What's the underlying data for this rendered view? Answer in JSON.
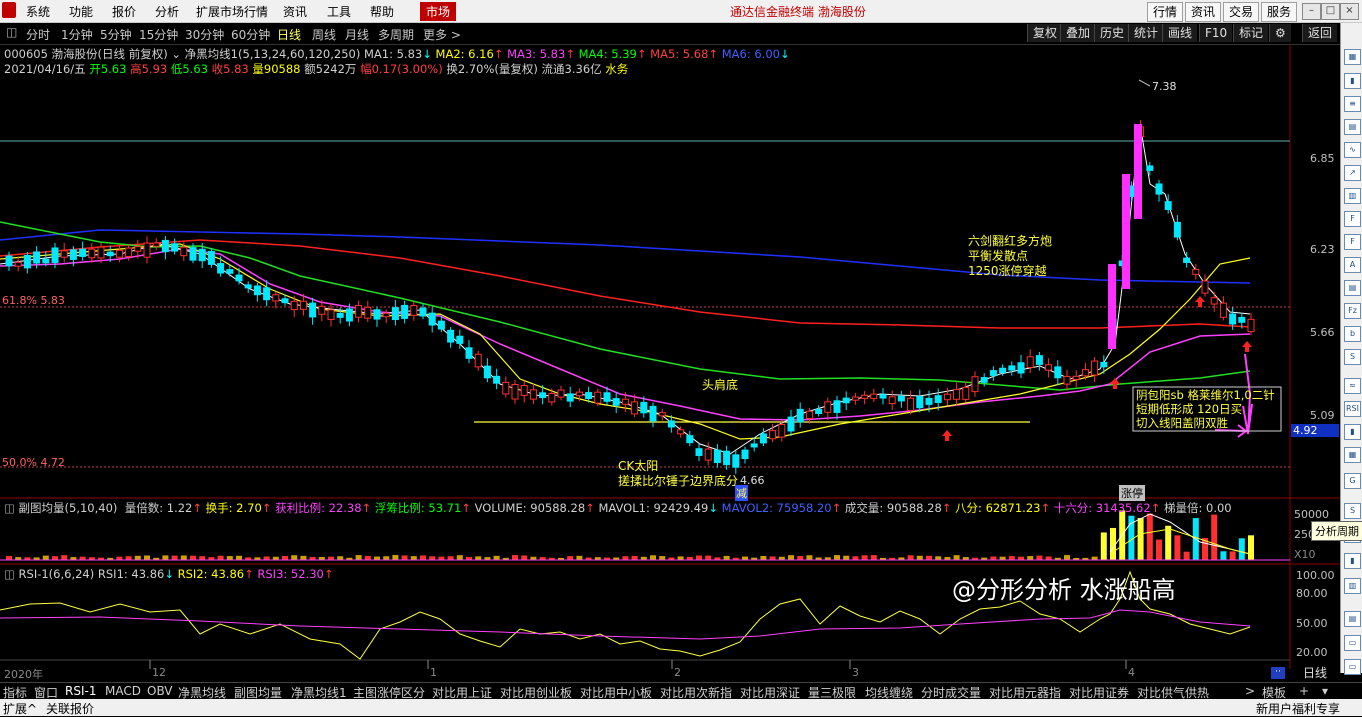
{
  "menu": {
    "items": [
      "系统",
      "功能",
      "报价",
      "分析",
      "扩展市场行情",
      "资讯",
      "工具",
      "帮助"
    ],
    "market": "市场",
    "brand": "通达信金融终端  渤海股份",
    "right_buttons": [
      "行情",
      "资讯",
      "交易",
      "服务"
    ]
  },
  "toolbar": {
    "periods": [
      "分时",
      "1分钟",
      "5分钟",
      "15分钟",
      "30分钟",
      "60分钟",
      "日线",
      "周线",
      "月线",
      "多周期",
      "更多 >"
    ],
    "active": "日线",
    "right": [
      "复权",
      "叠加",
      "历史",
      "统计",
      "画线",
      "F10",
      "标记",
      "⚙",
      "返回"
    ]
  },
  "header": {
    "line1": {
      "code": "000605 渤海股份(日线 前复权)",
      "indicator": "净黑均线1(5,13,24,60,120,250)",
      "ma1": "MA1: 5.83",
      "ma2": "MA2: 6.16",
      "ma3": "MA3: 5.83",
      "ma4": "MA4: 5.39",
      "ma5": "MA5: 5.68",
      "ma6": "MA6: 6.00"
    },
    "line2": {
      "date": "2021/04/16/五",
      "open": "开5.63",
      "high": "高5.93",
      "low": "低5.63",
      "close": "收5.83",
      "vol": "量90588",
      "amount": "额5242万",
      "change": "幅0.17(3.00%)",
      "turnover": "换2.70%(量复权)",
      "float": "流通3.36亿",
      "sector": "水务"
    }
  },
  "price_axis": [
    "6.85",
    "6.23",
    "5.66",
    "5.09"
  ],
  "price_current": "4.92",
  "fib": {
    "top": "61.8% 5.83",
    "bottom": "50.0% 4.72"
  },
  "annotations": {
    "peak": "7.38",
    "low": "4.66",
    "liujian": [
      "六剑翻红多方炮",
      "平衡发散点",
      "1250涨停穿越"
    ],
    "toujian": "头肩底",
    "ck": [
      "CK太阳",
      "搓揉比尔锤子边界底分"
    ],
    "jian": "减",
    "zhangting": "涨停",
    "box": [
      "阴包阳sb 格莱维尔1,0二针",
      "短期低形成 120日买",
      "切入线阳盖阴双胜"
    ],
    "watermark": "@分形分析 水涨船高"
  },
  "sub1": {
    "name": "副图均量(5,10,40)",
    "items": [
      {
        "t": "量倍数: 1.22",
        "c": "w"
      },
      {
        "t": "换手: 2.70",
        "c": "y"
      },
      {
        "t": "获利比例: 22.38",
        "c": "m"
      },
      {
        "t": "浮筹比例: 53.71",
        "c": "g"
      },
      {
        "t": "VOLUME: 90588.28",
        "c": "w"
      },
      {
        "t": "MAVOL1: 92429.49",
        "c": "w"
      },
      {
        "t": "MAVOL2: 75958.20",
        "c": "b"
      },
      {
        "t": "成交量: 90588.28",
        "c": "w"
      },
      {
        "t": "八分: 62871.23",
        "c": "y"
      },
      {
        "t": "十六分: 31435.62",
        "c": "m"
      },
      {
        "t": "梯量倍: 0.00",
        "c": "w"
      }
    ],
    "axis": [
      "50000",
      "25000"
    ],
    "unit": "X10",
    "tooltip": "分析周期"
  },
  "sub2": {
    "name": "RSI-1(6,6,24)",
    "rsi1": "RSI1: 43.86",
    "rsi2": "RSI2: 43.86",
    "rsi3": "RSI3: 52.30",
    "axis": [
      "100.00",
      "80.00",
      "50.00",
      "20.00"
    ]
  },
  "date_axis": [
    "2020年",
    "12",
    "1",
    "2",
    "3",
    "4"
  ],
  "tabs": [
    "指标",
    "窗口",
    "RSI-1",
    "MACD",
    "OBV",
    "净黑均线",
    "副图均量",
    "净黑均线1",
    "主图涨停区分",
    "对比用上证",
    "对比用创业板",
    "对比用中小板",
    "对比用次新指",
    "对比用深证",
    "量三极限",
    "均线缠绕",
    "分时成交量",
    "对比用元器指",
    "对比用证券",
    "对比供气供热",
    ">",
    "模板",
    "+",
    "▾"
  ],
  "right_period": "日线",
  "status": {
    "left": [
      "扩展^",
      "关联报价"
    ],
    "right": "新用户福利专享"
  },
  "colors": {
    "bull": "#ff3030",
    "bear": "#00ffff",
    "accent": "#c00000",
    "magenta": "#ff40ff"
  }
}
